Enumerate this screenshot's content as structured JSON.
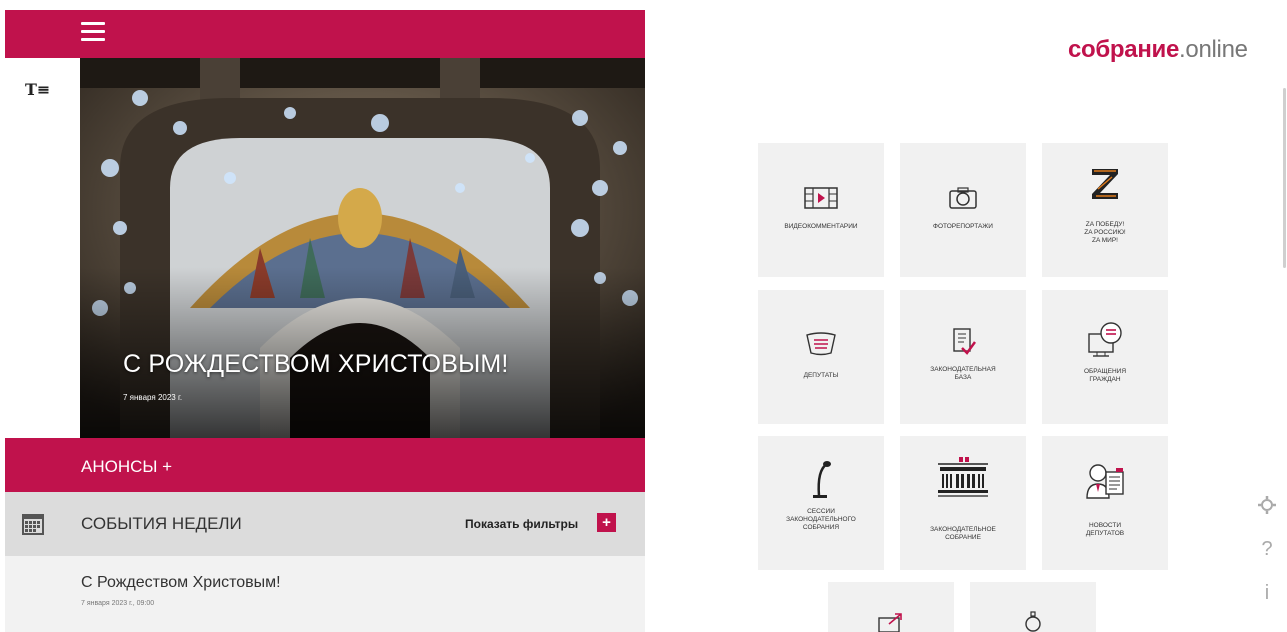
{
  "header": {
    "menu_icon": "hamburger-icon",
    "font_toggle": "T≡"
  },
  "hero": {
    "title": "С РОЖДЕСТВОМ ХРИСТОВЫМ!",
    "date": "7 января 2023 г."
  },
  "announcements": {
    "label": "АНОНСЫ +"
  },
  "events": {
    "label": "СОБЫТИЯ НЕДЕЛИ",
    "filters_label": "Показать фильтры",
    "filters_plus": "+",
    "calendar_icon": "calendar-icon"
  },
  "event_item": {
    "title": "С Рождеством Христовым!",
    "date": "7 января 2023 г., 09:00"
  },
  "brand": {
    "name": "собрание",
    "suffix": ".online",
    "accent": "#c0124c"
  },
  "tiles": [
    {
      "label_lines": [
        "ВИДЕОКОММЕНТАРИИ"
      ],
      "icon": "video-icon"
    },
    {
      "label_lines": [
        "ФОТОРЕПОРТАЖИ"
      ],
      "icon": "camera-icon"
    },
    {
      "label_lines": [
        "ZA ПОБЕДУ!",
        "ZA РОССИЮ!",
        "ZA МИР!"
      ],
      "icon": "z-ribbon-icon"
    },
    {
      "label_lines": [
        "ДЕПУТАТЫ"
      ],
      "icon": "deputies-icon"
    },
    {
      "label_lines": [
        "ЗАКОНОДАТЕЛЬНАЯ",
        "БАЗА"
      ],
      "icon": "legislative-doc-icon"
    },
    {
      "label_lines": [
        "ОБРАЩЕНИЯ",
        "ГРАЖДАН"
      ],
      "icon": "appeals-icon"
    },
    {
      "label_lines": [
        "СЕССИИ",
        "ЗАКОНОДАТЕЛЬНОГО",
        "СОБРАНИЯ"
      ],
      "icon": "microphone-icon"
    },
    {
      "label_lines": [
        "ЗАКОНОДАТЕЛЬНОЕ",
        "СОБРАНИЕ"
      ],
      "icon": "building-icon"
    },
    {
      "label_lines": [
        "НОВОСТИ",
        "ДЕПУТАТОВ"
      ],
      "icon": "deputy-news-icon"
    }
  ],
  "side": {
    "settings_icon": "gear-icon",
    "help": "?",
    "info": "i"
  }
}
